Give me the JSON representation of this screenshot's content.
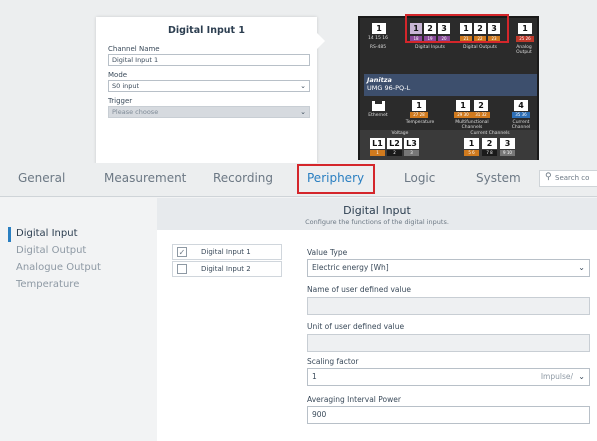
{
  "popup": {
    "title": "Digital Input 1",
    "channel_label": "Channel Name",
    "channel_value": "Digital Input 1",
    "mode_label": "Mode",
    "mode_value": "S0 input",
    "trigger_label": "Trigger",
    "trigger_placeholder": "Please choose"
  },
  "device": {
    "rs485_num": "1",
    "rs485_pins": "14 15 16",
    "rs485_label": "RS-485",
    "di_nums": [
      "1",
      "2",
      "3"
    ],
    "di_pins": [
      "18",
      "19",
      "20"
    ],
    "di_label": "Digital Inputs",
    "do_nums": [
      "1",
      "2",
      "3"
    ],
    "do_pins": [
      "21",
      "22",
      "23"
    ],
    "do_label": "Digital Outputs",
    "ao_num": "1",
    "ao_pins": "25 26",
    "ao_label": "Analog Output",
    "brand": "Janitza",
    "model": "UMG 96-PQ-L",
    "eth_label": "Ethernet",
    "temp_num": "1",
    "temp_pins": "27 28",
    "temp_label": "Temperature",
    "mf_nums": [
      "1",
      "2"
    ],
    "mf_pins": [
      "29 30",
      "31 32"
    ],
    "mf_label": "Multifunctional Channels",
    "cc_num": "4",
    "cc_pins": "35 36",
    "cc_label": "Current Channel",
    "voltage_label": "Voltage",
    "voltage_boxes": [
      "L1",
      "L2",
      "L3"
    ],
    "voltage_pins": [
      "1",
      "2",
      "3"
    ],
    "current_label": "Current Channels",
    "current_nums": [
      "1",
      "2",
      "3"
    ],
    "current_pins": [
      "5 6",
      "7 8",
      "9 10"
    ]
  },
  "nav": {
    "tabs": [
      "General",
      "Measurement",
      "Recording",
      "Periphery",
      "Logic",
      "System"
    ],
    "active": "Periphery",
    "search_placeholder": "Search co"
  },
  "sidebar": {
    "items": [
      "Digital Input",
      "Digital Output",
      "Analogue Output",
      "Temperature"
    ],
    "active": "Digital Input"
  },
  "main": {
    "title": "Digital Input",
    "subtitle": "Configure the functions of the digital inputs.",
    "inputs": [
      {
        "label": "Digital Input 1",
        "checked": true,
        "check_glyph": "✓"
      },
      {
        "label": "Digital Input 2",
        "checked": false,
        "check_glyph": ""
      }
    ],
    "value_type_label": "Value Type",
    "value_type_value": "Electric energy [Wh]",
    "udv_name_label": "Name of user defined value",
    "udv_name_value": "",
    "udv_unit_label": "Unit of user defined value",
    "udv_unit_value": "",
    "scaling_label": "Scaling factor",
    "scaling_value": "1",
    "scaling_unit": "Impulse/",
    "avg_label": "Averaging Interval Power",
    "avg_value": "900"
  },
  "colors": {
    "accent": "#2a7fc1",
    "highlight": "#d4262b",
    "pin_orange": "#d07a1e",
    "pin_purple": "#8a4a9a",
    "pin_red": "#c0392b",
    "pin_blue": "#2e6fb6"
  }
}
